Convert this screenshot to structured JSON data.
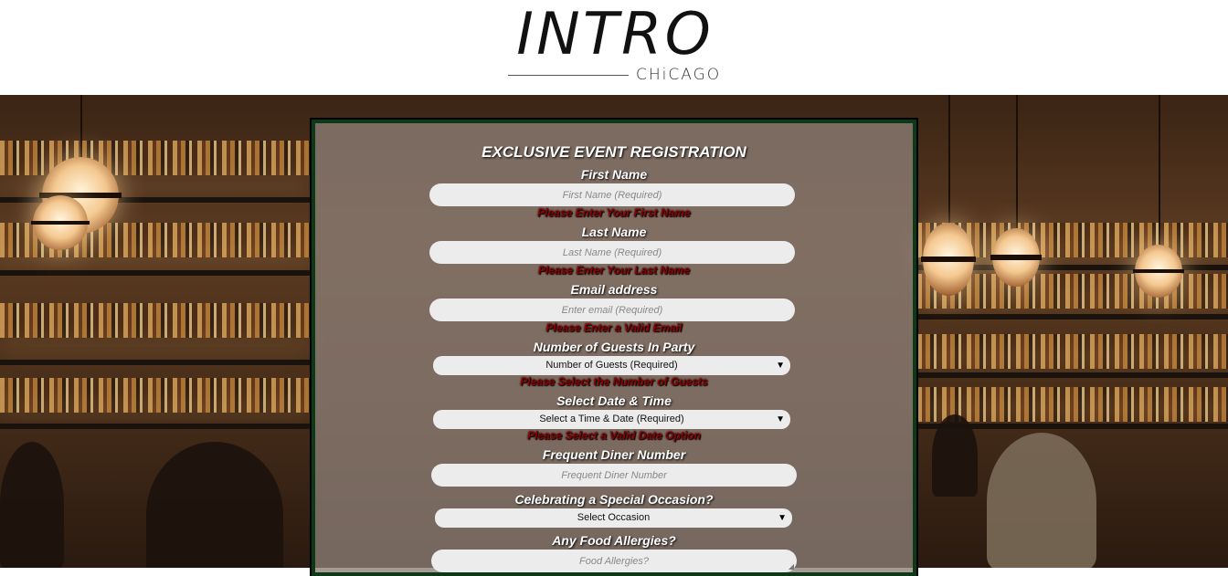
{
  "logo": {
    "word": "INTRO",
    "city": "CHiCAGO"
  },
  "form": {
    "title": "EXCLUSIVE EVENT REGISTRATION",
    "first_name": {
      "label": "First Name",
      "placeholder": "First Name (Required)",
      "error": "Please Enter Your First Name"
    },
    "last_name": {
      "label": "Last Name",
      "placeholder": "Last Name (Required)",
      "error": "Please Enter Your Last Name"
    },
    "email": {
      "label": "Email address",
      "placeholder": "Enter email (Required)",
      "error": "Please Enter a Valid Email"
    },
    "guests": {
      "label": "Number of Guests In Party",
      "selected": "Number of Guests (Required)",
      "error": "Please Select the Number of Guests",
      "arrow": "▼"
    },
    "datetime": {
      "label": "Select Date & Time",
      "selected": "Select a Time & Date (Required)",
      "error": "Please Select a Valid Date Option",
      "arrow": "▼"
    },
    "diner_number": {
      "label": "Frequent Diner Number",
      "placeholder": "Frequent Diner Number"
    },
    "occasion": {
      "label": "Celebrating a Special Occasion?",
      "selected": "Select Occasion",
      "arrow": "▼"
    },
    "allergies": {
      "label": "Any Food Allergies?",
      "placeholder": "Food Allergies?"
    }
  }
}
